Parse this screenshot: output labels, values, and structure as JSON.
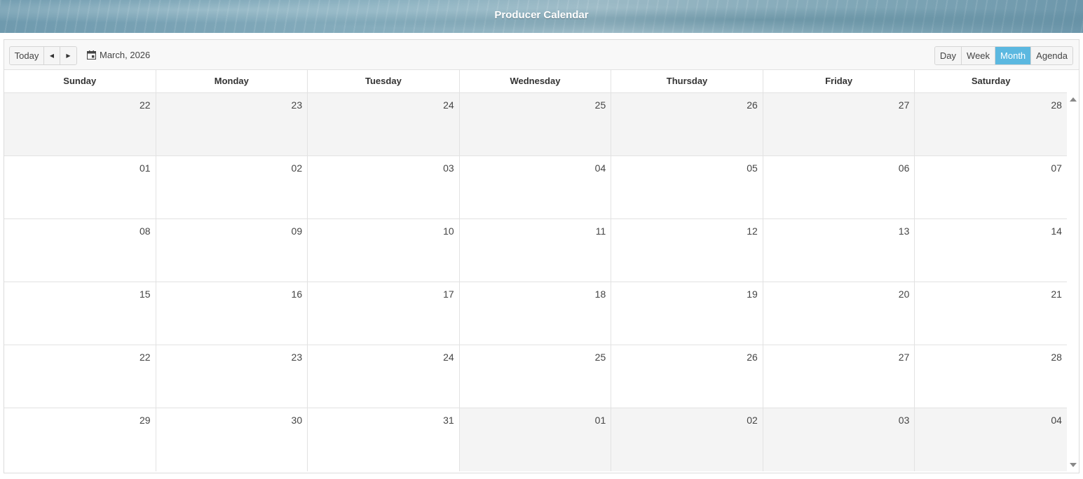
{
  "header": {
    "title": "Producer Calendar"
  },
  "toolbar": {
    "today_label": "Today",
    "prev_icon": "caret-left-icon",
    "next_icon": "caret-right-icon",
    "current_date": "March, 2026",
    "calendar_icon": "calendar-icon",
    "views": [
      {
        "label": "Day",
        "active": false
      },
      {
        "label": "Week",
        "active": false
      },
      {
        "label": "Month",
        "active": true
      },
      {
        "label": "Agenda",
        "active": false
      }
    ],
    "active_color": "#5bb8e0"
  },
  "weekdays": [
    "Sunday",
    "Monday",
    "Tuesday",
    "Wednesday",
    "Thursday",
    "Friday",
    "Saturday"
  ],
  "weeks": [
    {
      "days": [
        {
          "num": "22",
          "other": true
        },
        {
          "num": "23",
          "other": true
        },
        {
          "num": "24",
          "other": true
        },
        {
          "num": "25",
          "other": true
        },
        {
          "num": "26",
          "other": true
        },
        {
          "num": "27",
          "other": true
        },
        {
          "num": "28",
          "other": true
        }
      ]
    },
    {
      "days": [
        {
          "num": "01",
          "other": false
        },
        {
          "num": "02",
          "other": false
        },
        {
          "num": "03",
          "other": false
        },
        {
          "num": "04",
          "other": false
        },
        {
          "num": "05",
          "other": false
        },
        {
          "num": "06",
          "other": false
        },
        {
          "num": "07",
          "other": false
        }
      ]
    },
    {
      "days": [
        {
          "num": "08",
          "other": false
        },
        {
          "num": "09",
          "other": false
        },
        {
          "num": "10",
          "other": false
        },
        {
          "num": "11",
          "other": false
        },
        {
          "num": "12",
          "other": false
        },
        {
          "num": "13",
          "other": false
        },
        {
          "num": "14",
          "other": false
        }
      ]
    },
    {
      "days": [
        {
          "num": "15",
          "other": false
        },
        {
          "num": "16",
          "other": false
        },
        {
          "num": "17",
          "other": false
        },
        {
          "num": "18",
          "other": false
        },
        {
          "num": "19",
          "other": false
        },
        {
          "num": "20",
          "other": false
        },
        {
          "num": "21",
          "other": false
        }
      ]
    },
    {
      "days": [
        {
          "num": "22",
          "other": false
        },
        {
          "num": "23",
          "other": false
        },
        {
          "num": "24",
          "other": false
        },
        {
          "num": "25",
          "other": false
        },
        {
          "num": "26",
          "other": false
        },
        {
          "num": "27",
          "other": false
        },
        {
          "num": "28",
          "other": false
        }
      ]
    },
    {
      "days": [
        {
          "num": "29",
          "other": false
        },
        {
          "num": "30",
          "other": false
        },
        {
          "num": "31",
          "other": false
        },
        {
          "num": "01",
          "other": true
        },
        {
          "num": "02",
          "other": true
        },
        {
          "num": "03",
          "other": true
        },
        {
          "num": "04",
          "other": true
        }
      ]
    }
  ]
}
